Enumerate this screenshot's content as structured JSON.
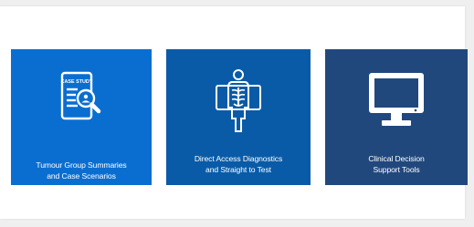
{
  "tiles": [
    {
      "label": "Tumour Group Summaries\nand Case Scenarios",
      "icon": "case-study-icon",
      "icon_text": "CASE STUDY",
      "color": "#0a6ed1"
    },
    {
      "label": "Direct Access Diagnostics\nand Straight to Test",
      "icon": "xray-icon",
      "color": "#095ba8"
    },
    {
      "label": "Clinical Decision\nSupport Tools",
      "icon": "monitor-icon",
      "color": "#21487d"
    }
  ],
  "colors": {
    "page_background": "#efefef",
    "panel_background": "#ffffff",
    "icon_color": "#ffffff"
  }
}
